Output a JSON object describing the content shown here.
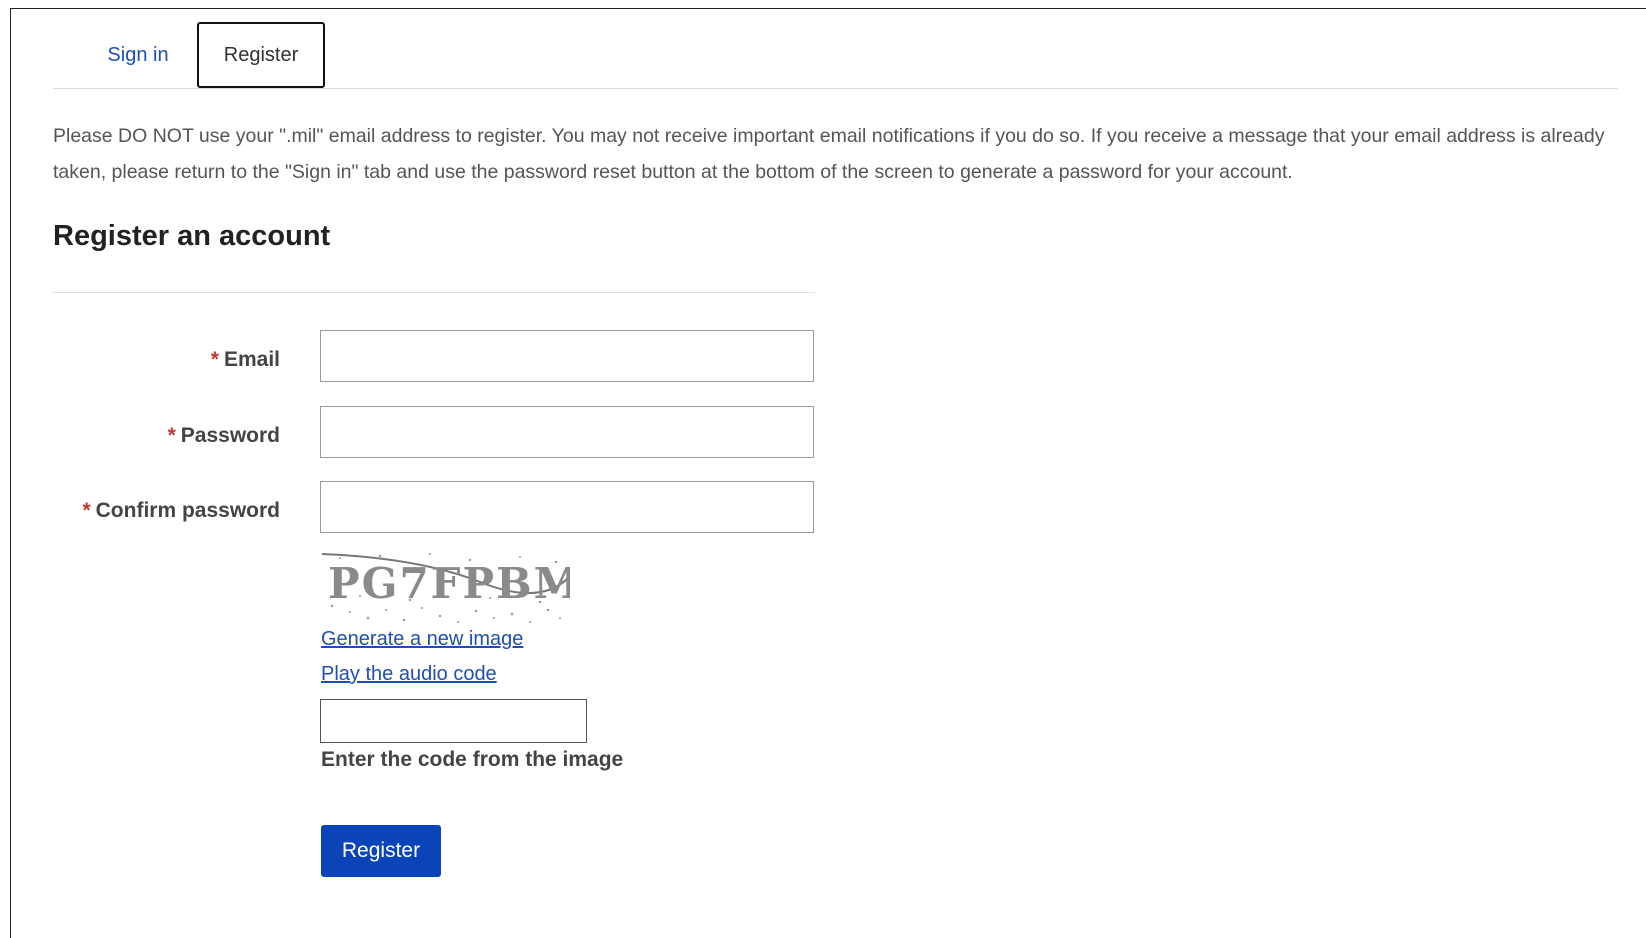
{
  "tabs": [
    {
      "label": "Sign in",
      "active": false
    },
    {
      "label": "Register",
      "active": true
    }
  ],
  "notice": "Please DO NOT use your \".mil\" email address to register. You may not receive important email notifications if you do so. If you receive a message that your email address is already taken, please return to the \"Sign in\" tab and use the password reset button at the bottom of the screen to generate a password for your account.",
  "form": {
    "heading": "Register an account",
    "required_marker": "*",
    "fields": [
      {
        "label": "Email",
        "value": "",
        "type": "email"
      },
      {
        "label": "Password",
        "value": "",
        "type": "password"
      },
      {
        "label": "Confirm password",
        "value": "",
        "type": "password"
      }
    ],
    "captcha": {
      "code": "PG7FPBM",
      "new_image_link": "Generate a new image",
      "audio_link": "Play the audio code",
      "input_value": "",
      "input_label": "Enter the code from the image"
    },
    "submit_label": "Register"
  },
  "colors": {
    "link": "#1f4fb6",
    "required": "#c0392b",
    "button": "#0b44b9"
  }
}
